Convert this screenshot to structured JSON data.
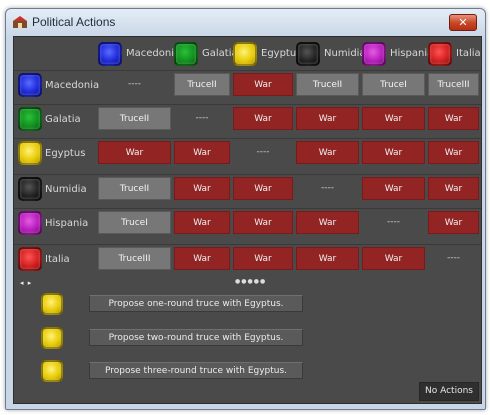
{
  "window": {
    "title": "Political Actions",
    "close_glyph": "✕"
  },
  "factions": [
    {
      "name": "Macedonia",
      "icon": "macedonia-emblem-icon",
      "color": "#1b26d6"
    },
    {
      "name": "Galatia",
      "icon": "galatia-emblem-icon",
      "color": "#0f8e1d"
    },
    {
      "name": "Egyptus",
      "icon": "egyptus-emblem-icon",
      "color": "#e6c900"
    },
    {
      "name": "Numidia",
      "icon": "numidia-emblem-icon",
      "color": "#1f1f1f"
    },
    {
      "name": "Hispania",
      "icon": "hispania-emblem-icon",
      "color": "#b41ab8"
    },
    {
      "name": "Italia",
      "icon": "italia-emblem-icon",
      "color": "#cf1d1d"
    }
  ],
  "matrix": [
    [
      "----",
      "TruceII",
      "War",
      "TruceII",
      "TruceI",
      "TruceIII"
    ],
    [
      "TruceII",
      "----",
      "War",
      "War",
      "War",
      "War"
    ],
    [
      "War",
      "War",
      "----",
      "War",
      "War",
      "War"
    ],
    [
      "TruceII",
      "War",
      "War",
      "----",
      "War",
      "War"
    ],
    [
      "TruceI",
      "War",
      "War",
      "War",
      "----",
      "War"
    ],
    [
      "TruceIII",
      "War",
      "War",
      "War",
      "War",
      "----"
    ]
  ],
  "status_colors": {
    "war": "#922424",
    "truce": "#777777"
  },
  "pager": {
    "arrows": "◂ ▸",
    "dots": "●●●●●"
  },
  "proposals": [
    {
      "label": "Propose one-round truce with Egyptus.",
      "icon": "egyptus-emblem-icon"
    },
    {
      "label": "Propose two-round truce with Egyptus.",
      "icon": "egyptus-emblem-icon"
    },
    {
      "label": "Propose three-round truce with Egyptus.",
      "icon": "egyptus-emblem-icon"
    }
  ],
  "no_actions_label": "No Actions"
}
